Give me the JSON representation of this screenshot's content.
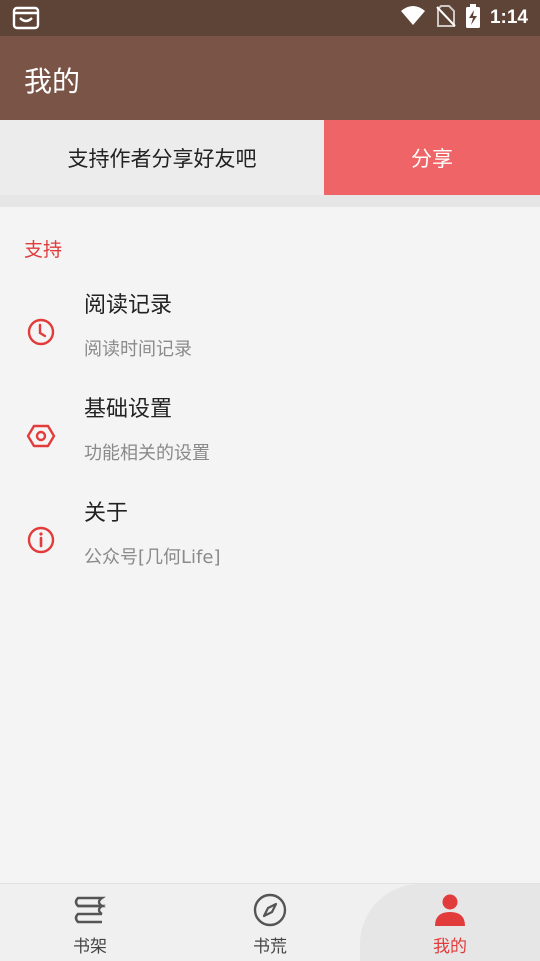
{
  "status_bar": {
    "time": "1:14",
    "icons": [
      "app-notification-icon",
      "wifi-icon",
      "no-sim-icon",
      "battery-charging-icon"
    ]
  },
  "app_bar": {
    "title": "我的"
  },
  "share": {
    "text": "支持作者分享好友吧",
    "button_label": "分享"
  },
  "section": {
    "title": "支持",
    "items": [
      {
        "title": "阅读记录",
        "subtitle": "阅读时间记录",
        "icon": "clock-icon"
      },
      {
        "title": "基础设置",
        "subtitle": "功能相关的设置",
        "icon": "settings-hexagon-icon"
      },
      {
        "title": "关于",
        "subtitle": "公众号[几何Life]",
        "icon": "info-icon"
      }
    ]
  },
  "bottom_nav": {
    "items": [
      {
        "label": "书架",
        "icon": "bookshelf-icon",
        "active": false
      },
      {
        "label": "书荒",
        "icon": "compass-icon",
        "active": false
      },
      {
        "label": "我的",
        "icon": "person-icon",
        "active": true
      }
    ]
  },
  "colors": {
    "status_bar": "#5e4437",
    "app_bar": "#7a5446",
    "accent_red": "#e23b3b",
    "share_button": "#ef6466"
  }
}
